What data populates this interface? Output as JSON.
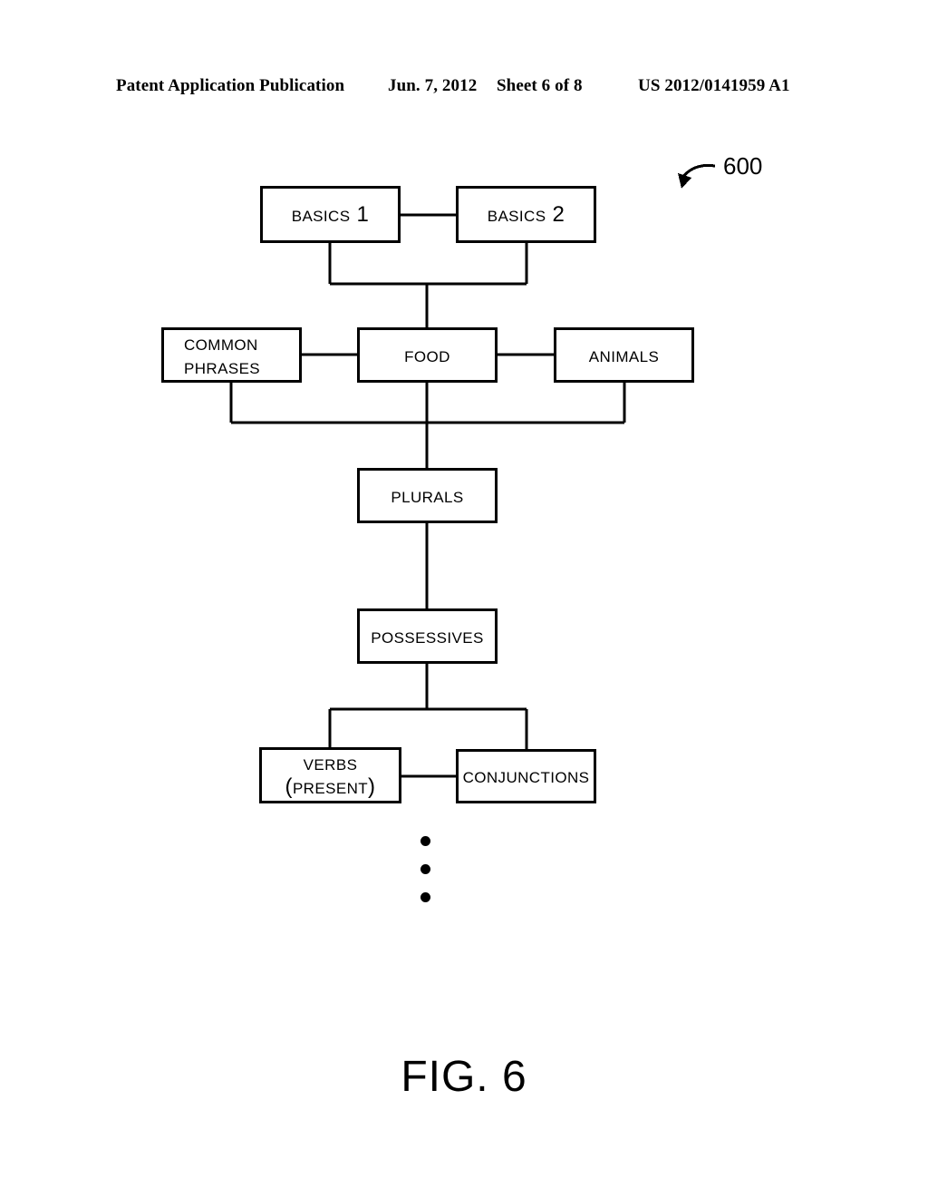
{
  "header": {
    "publication": "Patent Application Publication",
    "date": "Jun. 7, 2012",
    "sheet": "Sheet 6 of 8",
    "publication_number": "US 2012/0141959 A1"
  },
  "figure": {
    "caption": "FIG. 6",
    "reference_numeral": "600",
    "nodes": [
      {
        "id": "basics1",
        "label": "Basics 1"
      },
      {
        "id": "basics2",
        "label": "Basics 2"
      },
      {
        "id": "common",
        "label": "Common\nPhrases"
      },
      {
        "id": "food",
        "label": "Food"
      },
      {
        "id": "animals",
        "label": "Animals"
      },
      {
        "id": "plurals",
        "label": "Plurals"
      },
      {
        "id": "possessives",
        "label": "Possessives"
      },
      {
        "id": "verbs",
        "label": "Verbs\n(Present)"
      },
      {
        "id": "conjunctions",
        "label": "Conjunctions"
      }
    ],
    "edges": [
      {
        "from": "basics1",
        "to": "basics2",
        "style": "horizontal"
      },
      {
        "from": "basics1",
        "to": "food",
        "style": "drop-bus"
      },
      {
        "from": "basics2",
        "to": "food",
        "style": "drop-bus"
      },
      {
        "from": "common",
        "to": "food",
        "style": "horizontal"
      },
      {
        "from": "food",
        "to": "animals",
        "style": "horizontal"
      },
      {
        "from": "common",
        "to": "plurals",
        "style": "drop-bus"
      },
      {
        "from": "animals",
        "to": "plurals",
        "style": "drop-bus"
      },
      {
        "from": "food",
        "to": "plurals",
        "style": "vertical"
      },
      {
        "from": "plurals",
        "to": "possessives",
        "style": "vertical"
      },
      {
        "from": "possessives",
        "to": "verbs",
        "style": "split-bus"
      },
      {
        "from": "possessives",
        "to": "conjunctions",
        "style": "split-bus"
      },
      {
        "from": "verbs",
        "to": "conjunctions",
        "style": "horizontal"
      }
    ],
    "continuation_indicator": "vertical-ellipsis"
  },
  "colors": {
    "ink": "#000000",
    "paper": "#ffffff"
  }
}
